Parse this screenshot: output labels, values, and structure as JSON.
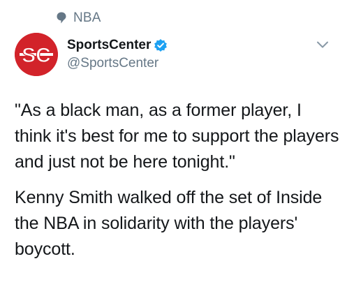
{
  "social_context": {
    "icon": "topic-bubble-icon",
    "label": "NBA"
  },
  "author": {
    "avatar_icon": "espn-sportscenter-logo",
    "avatar_text": "SC",
    "display_name": "SportsCenter",
    "verified_icon": "verified-badge-icon",
    "handle": "@SportsCenter"
  },
  "menu": {
    "icon": "chevron-down-icon"
  },
  "tweet": {
    "paragraphs": [
      "\"As a black man, as a former player, I think it's best for me to support the players and just not be here tonight.\"",
      "Kenny Smith walked off the set of Inside the NBA in solidarity with the players' boycott."
    ]
  },
  "colors": {
    "brand_red": "#d2232a",
    "verified_blue": "#1da1f2",
    "secondary_text": "#657786",
    "primary_text": "#14171a"
  }
}
